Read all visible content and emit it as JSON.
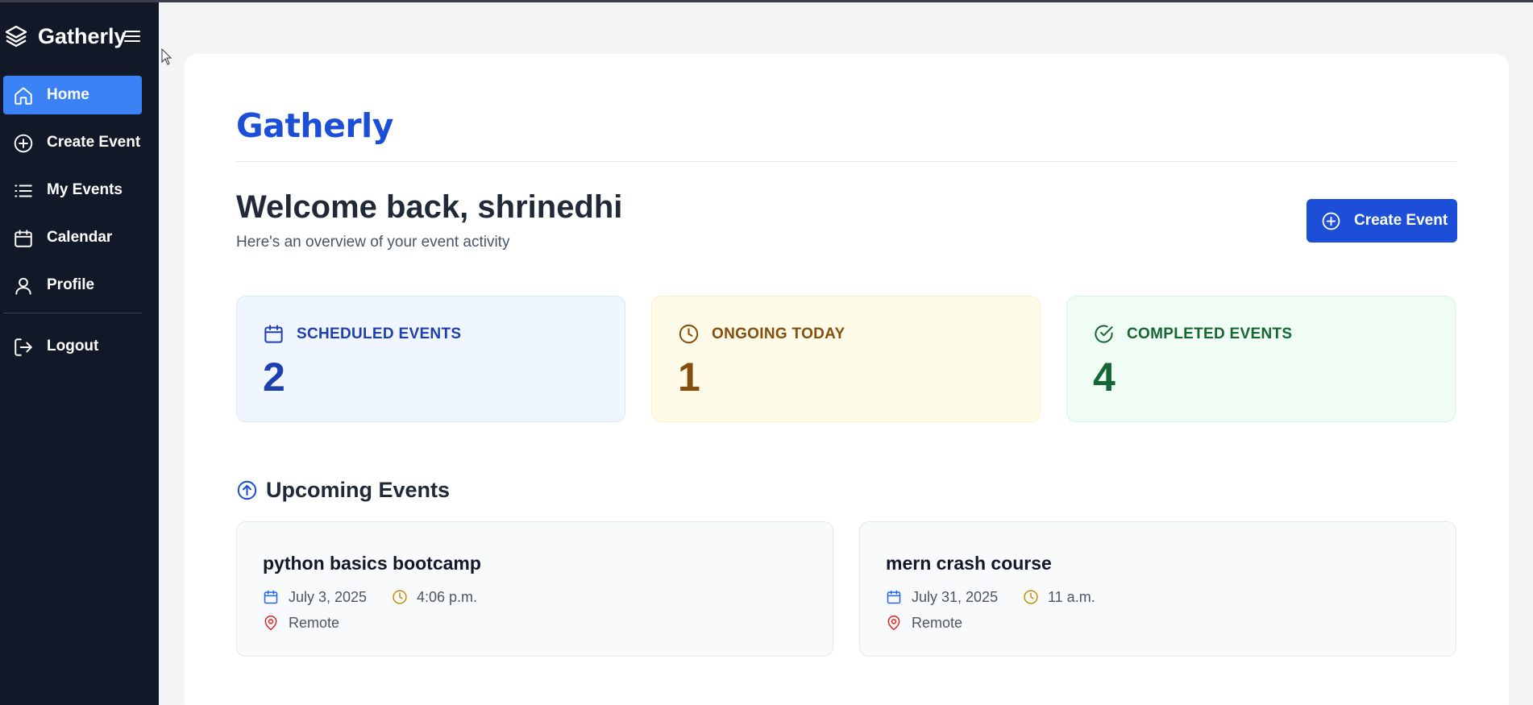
{
  "app": {
    "name": "Gatherly"
  },
  "sidebar": {
    "items": [
      {
        "label": "Home",
        "icon": "home-icon",
        "active": true
      },
      {
        "label": "Create Event",
        "icon": "plus-circle-icon",
        "active": false
      },
      {
        "label": "My Events",
        "icon": "list-icon",
        "active": false
      },
      {
        "label": "Calendar",
        "icon": "calendar-icon",
        "active": false
      },
      {
        "label": "Profile",
        "icon": "user-icon",
        "active": false
      }
    ],
    "logout": {
      "label": "Logout",
      "icon": "logout-icon"
    }
  },
  "main": {
    "brand": "Gatherly",
    "welcome": "Welcome back, shrinedhi",
    "subtitle": "Here's an overview of your event activity",
    "create_button": "Create Event",
    "stats": [
      {
        "label": "SCHEDULED EVENTS",
        "value": "2",
        "icon": "calendar-icon",
        "color": "#1e40af"
      },
      {
        "label": "ONGOING TODAY",
        "value": "1",
        "icon": "clock-icon",
        "color": "#854d0e"
      },
      {
        "label": "COMPLETED EVENTS",
        "value": "4",
        "icon": "check-circle-icon",
        "color": "#166534"
      }
    ],
    "upcoming_title": "Upcoming Events",
    "events": [
      {
        "title": "python basics bootcamp",
        "date": "July 3, 2025",
        "time": "4:06 p.m.",
        "location": "Remote"
      },
      {
        "title": "mern crash course",
        "date": "July 31, 2025",
        "time": "11 a.m.",
        "location": "Remote"
      }
    ]
  },
  "colors": {
    "sidebar_bg": "#111827",
    "accent": "#3b82f6",
    "brand_blue": "#1d4ed8"
  }
}
